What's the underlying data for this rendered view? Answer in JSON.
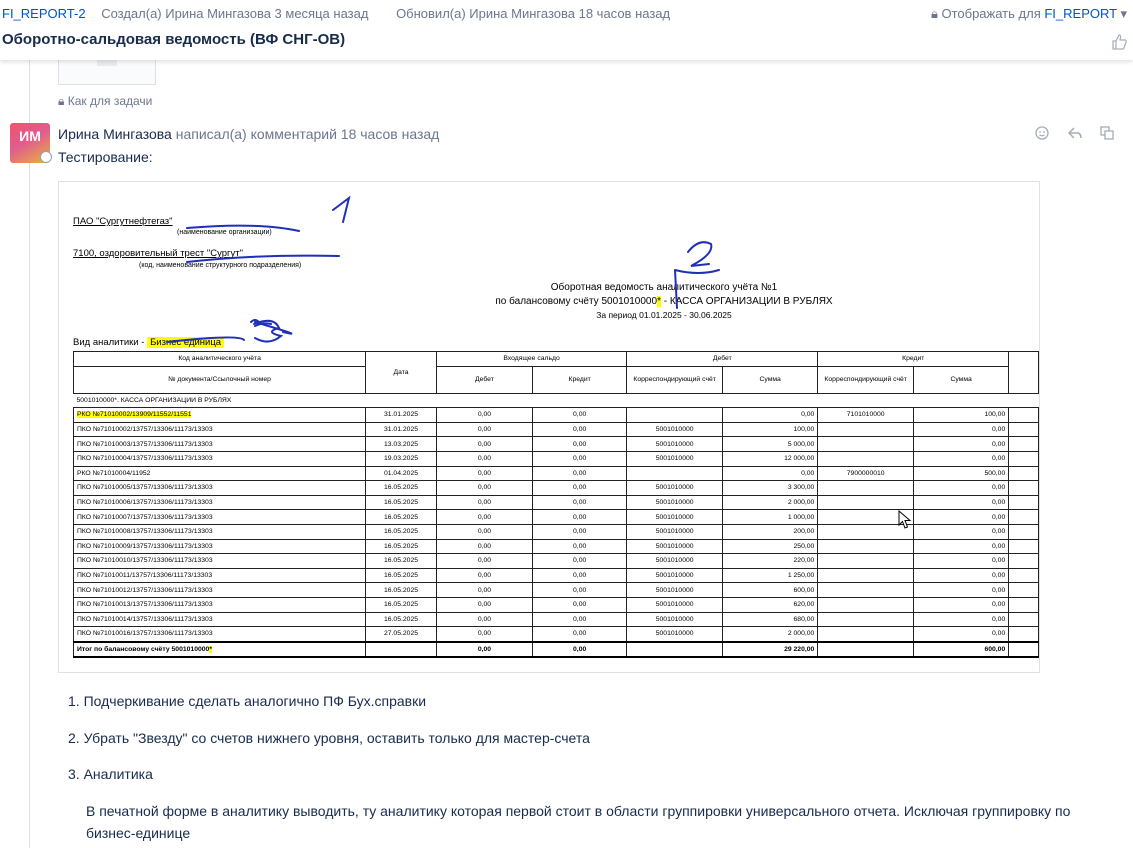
{
  "header": {
    "project_key": "FI_REPORT-2",
    "created": "Создал(а) Ирина Мингазова 3 месяца назад",
    "updated": "Обновил(а) Ирина Мингазова 18 часов назад",
    "restriction_prefix": "Отображать для",
    "restriction_project": "FI_REPORT",
    "title": "Оборотно-сальдовая ведомость (ВФ СНГ-ОВ)"
  },
  "task_label": "Как для задачи",
  "comment": {
    "avatar_initials": "ИМ",
    "author": "Ирина Мингазова",
    "action": "написал(а) комментарий 18 часов назад",
    "text": "Тестирование:"
  },
  "report": {
    "org": "ПАО \"Сургутнефтегаз\"",
    "org_caption": "(наименование организации)",
    "division": "7100, оздоровительный трест \"Сургут\"",
    "division_caption": "(код, наименование структурного подразделения)",
    "heading1": "Оборотная ведомость аналитического учёта №1",
    "heading2_pre": "по балансовому счёту 5001010000",
    "heading2_star": "*",
    "heading2_post": " - КАССА ОРГАНИЗАЦИИ В РУБЛЯХ",
    "period": "За период 01.01.2025 - 30.06.2025",
    "analytics_label": "Вид аналитики -",
    "analytics_value": "Бизнес единица",
    "col_code": "Код аналитического учёта",
    "col_doc": "№ документа/Ссылочный номер",
    "col_date": "Дата",
    "col_opening": "Входящее сальдо",
    "col_debit_group": "Дебет",
    "col_credit_group": "Кредит",
    "col_debit": "Дебет",
    "col_credit": "Кредит",
    "col_corr": "Корреспондирующий счёт",
    "col_sum": "Сумма",
    "section": "5001010000*. КАССА ОРГАНИЗАЦИИ В РУБЛЯХ",
    "rows": [
      {
        "doc": "РКО №71010002/13909/11552/11551",
        "date": "31.01.2025",
        "od": "0,00",
        "oc": "0,00",
        "dcorr": "",
        "dsum": "0,00",
        "ccorr": "7101010000",
        "csum": "100,00",
        "hl": true
      },
      {
        "doc": "ПКО №71010002/13757/13306/11173/13303",
        "date": "31.01.2025",
        "od": "0,00",
        "oc": "0,00",
        "dcorr": "5001010000",
        "dsum": "100,00",
        "ccorr": "",
        "csum": "0,00"
      },
      {
        "doc": "ПКО №71010003/13757/13306/11173/13303",
        "date": "13.03.2025",
        "od": "0,00",
        "oc": "0,00",
        "dcorr": "5001010000",
        "dsum": "5 000,00",
        "ccorr": "",
        "csum": "0,00"
      },
      {
        "doc": "ПКО №71010004/13757/13306/11173/13303",
        "date": "19.03.2025",
        "od": "0,00",
        "oc": "0,00",
        "dcorr": "5001010000",
        "dsum": "12 000,00",
        "ccorr": "",
        "csum": "0,00"
      },
      {
        "doc": "РКО №71010004/11952",
        "date": "01.04.2025",
        "od": "0,00",
        "oc": "0,00",
        "dcorr": "",
        "dsum": "0,00",
        "ccorr": "7900000010",
        "csum": "500,00"
      },
      {
        "doc": "ПКО №71010005/13757/13306/11173/13303",
        "date": "16.05.2025",
        "od": "0,00",
        "oc": "0,00",
        "dcorr": "5001010000",
        "dsum": "3 300,00",
        "ccorr": "",
        "csum": "0,00"
      },
      {
        "doc": "ПКО №71010006/13757/13306/11173/13303",
        "date": "16.05.2025",
        "od": "0,00",
        "oc": "0,00",
        "dcorr": "5001010000",
        "dsum": "2 000,00",
        "ccorr": "",
        "csum": "0,00"
      },
      {
        "doc": "ПКО №71010007/13757/13306/11173/13303",
        "date": "16.05.2025",
        "od": "0,00",
        "oc": "0,00",
        "dcorr": "5001010000",
        "dsum": "1 000,00",
        "ccorr": "",
        "csum": "0,00"
      },
      {
        "doc": "ПКО №71010008/13757/13306/11173/13303",
        "date": "16.05.2025",
        "od": "0,00",
        "oc": "0,00",
        "dcorr": "5001010000",
        "dsum": "200,00",
        "ccorr": "",
        "csum": "0,00"
      },
      {
        "doc": "ПКО №71010009/13757/13306/11173/13303",
        "date": "16.05.2025",
        "od": "0,00",
        "oc": "0,00",
        "dcorr": "5001010000",
        "dsum": "250,00",
        "ccorr": "",
        "csum": "0,00"
      },
      {
        "doc": "ПКО №71010010/13757/13306/11173/13303",
        "date": "16.05.2025",
        "od": "0,00",
        "oc": "0,00",
        "dcorr": "5001010000",
        "dsum": "220,00",
        "ccorr": "",
        "csum": "0,00"
      },
      {
        "doc": "ПКО №71010011/13757/13306/11173/13303",
        "date": "16.05.2025",
        "od": "0,00",
        "oc": "0,00",
        "dcorr": "5001010000",
        "dsum": "1 250,00",
        "ccorr": "",
        "csum": "0,00"
      },
      {
        "doc": "ПКО №71010012/13757/13306/11173/13303",
        "date": "16.05.2025",
        "od": "0,00",
        "oc": "0,00",
        "dcorr": "5001010000",
        "dsum": "600,00",
        "ccorr": "",
        "csum": "0,00"
      },
      {
        "doc": "ПКО №71010013/13757/13306/11173/13303",
        "date": "16.05.2025",
        "od": "0,00",
        "oc": "0,00",
        "dcorr": "5001010000",
        "dsum": "620,00",
        "ccorr": "",
        "csum": "0,00"
      },
      {
        "doc": "ПКО №71010014/13757/13306/11173/13303",
        "date": "16.05.2025",
        "od": "0,00",
        "oc": "0,00",
        "dcorr": "5001010000",
        "dsum": "680,00",
        "ccorr": "",
        "csum": "0,00"
      },
      {
        "doc": "ПКО №71010016/13757/13306/11173/13303",
        "date": "27.05.2025",
        "od": "0,00",
        "oc": "0,00",
        "dcorr": "5001010000",
        "dsum": "2 000,00",
        "ccorr": "",
        "csum": "0,00"
      }
    ],
    "total": {
      "label": "Итог по балансовому счёту 5001010000",
      "star": "*",
      "od": "0,00",
      "oc": "0,00",
      "dsum": "29 220,00",
      "csum": "600,00"
    }
  },
  "annotations": [
    "1",
    "2",
    "3"
  ],
  "list": [
    "1. Подчеркивание сделать аналогично ПФ Бух.справки",
    "2. Убрать \"Звезду\" со счетов нижнего уровня, оставить только для мастер-счета",
    "3. Аналитика"
  ],
  "paragraph": "В печатной форме в аналитику выводить, ту аналитику которая первой стоит в области группировки универсального отчета. Исключая группировку по бизнес-единице",
  "colors": {
    "link": "#0052cc",
    "muted": "#6b778c",
    "text": "#172b4d",
    "highlight": "#ffff00",
    "ink": "#1f2fb8"
  }
}
